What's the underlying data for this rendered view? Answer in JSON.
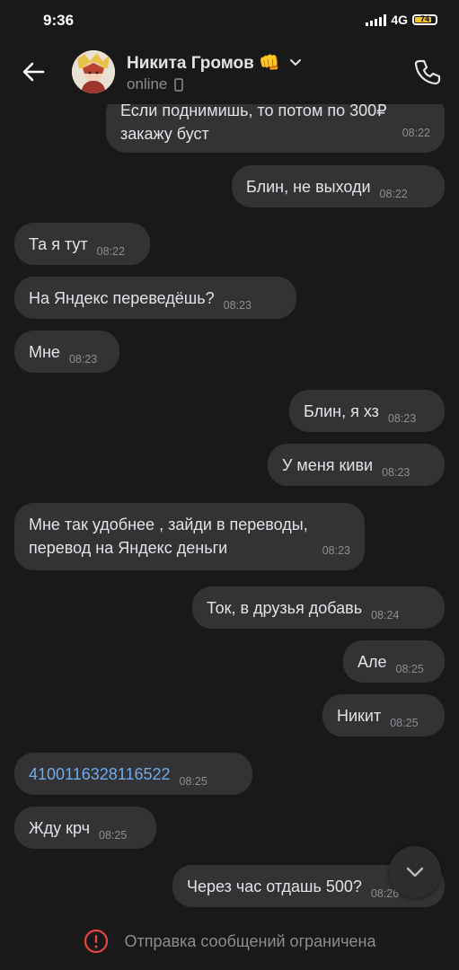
{
  "status_bar": {
    "time": "9:36",
    "network": "4G",
    "battery_level": "74",
    "battery_color": "#f4c430"
  },
  "header": {
    "contact_name": "Никита Громов",
    "name_emoji": "👊",
    "status": "online",
    "back_icon": "arrow-left-icon",
    "phone_icon": "phone-icon",
    "dropdown_icon": "chevron-down-icon"
  },
  "messages": [
    {
      "side": "out",
      "text": "Если поднимишь, то потом по 300₽ закажу буст",
      "time": "08:22"
    },
    {
      "side": "out",
      "text": "Блин, не выходи",
      "time": "08:22"
    },
    {
      "side": "in",
      "text": "Та я тут",
      "time": "08:22"
    },
    {
      "side": "in",
      "text": "На Яндекс переведёшь?",
      "time": "08:23"
    },
    {
      "side": "in",
      "text": "Мне",
      "time": "08:23"
    },
    {
      "side": "out",
      "text": "Блин, я хз",
      "time": "08:23"
    },
    {
      "side": "out",
      "text": "У меня киви",
      "time": "08:23"
    },
    {
      "side": "in",
      "text": "Мне так удобнее , зайди в переводы, перевод на Яндекс деньги",
      "time": "08:23"
    },
    {
      "side": "out",
      "text": "Ток, в друзья добавь",
      "time": "08:24"
    },
    {
      "side": "out",
      "text": "Але",
      "time": "08:25"
    },
    {
      "side": "out",
      "text": "Никит",
      "time": "08:25"
    },
    {
      "side": "in",
      "text": "4100116328116522",
      "time": "08:25"
    },
    {
      "side": "in",
      "text": "Жду крч",
      "time": "08:25"
    },
    {
      "side": "out",
      "text": "Через час отдашь 500?",
      "time": "08:26"
    }
  ],
  "footer": {
    "text": "Отправка сообщений ограничена",
    "icon": "alert-circle-icon",
    "icon_color": "#e64646"
  },
  "colors": {
    "background": "#19191a",
    "bubble": "#333335",
    "link": "#71aaeb"
  }
}
